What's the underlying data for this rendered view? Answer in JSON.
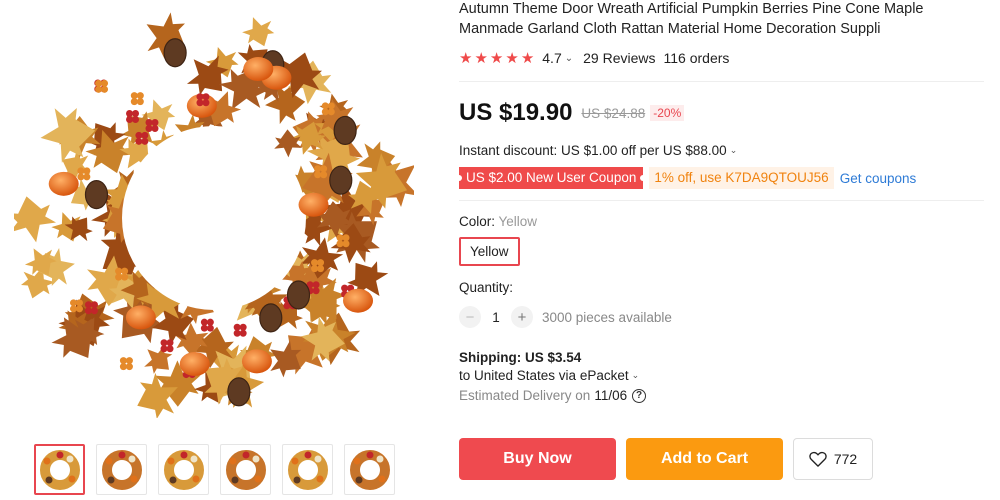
{
  "product": {
    "title": "Autumn Theme Door Wreath Artificial Pumpkin Berries Pine Cone Maple Manmade Garland Cloth Rattan Material Home Decoration Suppli",
    "rating": "4.7",
    "reviews": "29 Reviews",
    "orders": "116 orders",
    "star_count": 5
  },
  "price": {
    "current": "US $19.90",
    "original": "US $24.88",
    "discount": "-20%"
  },
  "instant_discount": "Instant discount: US $1.00 off per US $88.00",
  "coupons": {
    "new_user": "US $2.00 New User Coupon",
    "code": "1% off, use K7DA9QTOUJ56",
    "get_link": "Get coupons"
  },
  "color": {
    "label": "Color:",
    "selected": "Yellow",
    "option": "Yellow"
  },
  "quantity": {
    "label": "Quantity:",
    "value": "1",
    "available": "3000 pieces available",
    "minus": "−",
    "plus": "+"
  },
  "shipping": {
    "cost": "Shipping: US $3.54",
    "destination": "to United States via ePacket",
    "eta_label": "Estimated Delivery on",
    "eta_date": "11/06"
  },
  "actions": {
    "buy_now": "Buy Now",
    "add_to_cart": "Add to Cart",
    "wishlist_count": "772"
  },
  "colors": {
    "accent_red": "#ef4a4f",
    "accent_orange": "#fb9a10",
    "link_blue": "#2e7bd6",
    "star": "#ef4a4a"
  },
  "icons": [
    "star-icon",
    "chevron-down-icon",
    "minus-icon",
    "plus-icon",
    "help-icon",
    "heart-icon"
  ],
  "thumbnails": 6
}
